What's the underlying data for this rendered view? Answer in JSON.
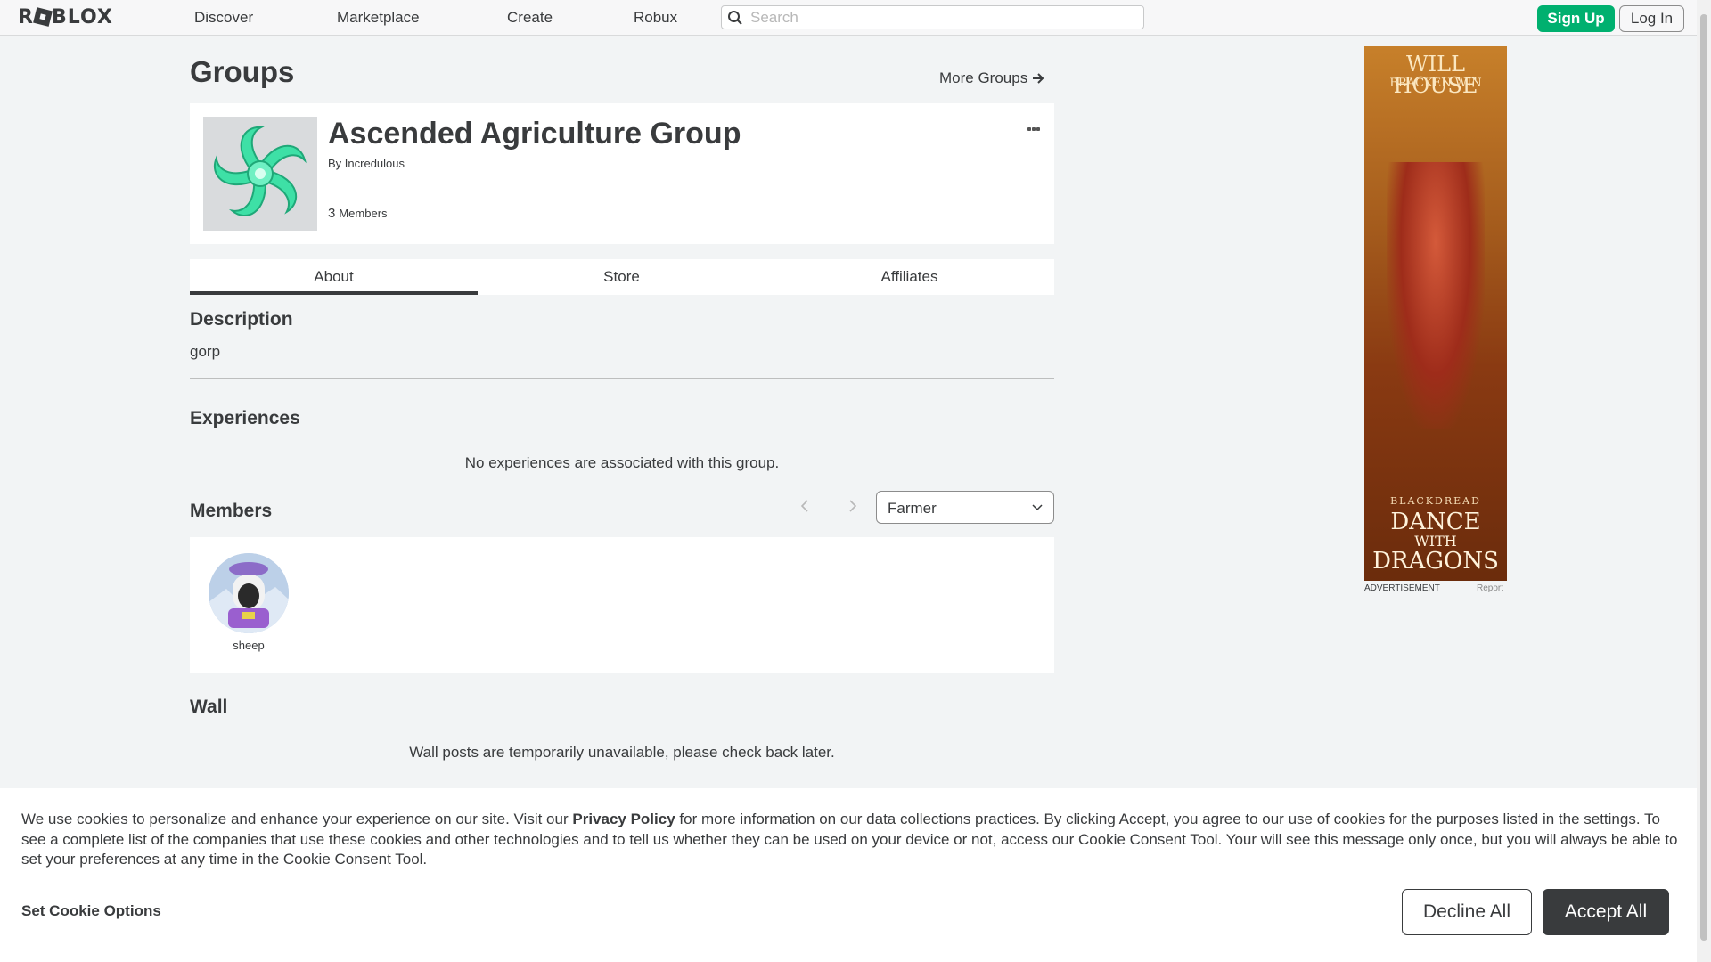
{
  "nav": {
    "logo": "ROBLOX",
    "links": [
      "Discover",
      "Marketplace",
      "Create",
      "Robux"
    ],
    "search_placeholder": "Search",
    "signup_label": "Sign Up",
    "login_label": "Log In"
  },
  "page": {
    "title": "Groups",
    "more_groups": "More Groups"
  },
  "group": {
    "name": "Ascended Agriculture Group",
    "by_prefix": "By",
    "owner": "Incredulous",
    "member_count": "3",
    "members_label": "Members",
    "emblem_icon": "group-emblem-icon"
  },
  "tabs": [
    {
      "label": "About",
      "active": true
    },
    {
      "label": "Store",
      "active": false
    },
    {
      "label": "Affiliates",
      "active": false
    }
  ],
  "about": {
    "description_heading": "Description",
    "description_text": "gorp",
    "experiences_heading": "Experiences",
    "experiences_empty": "No experiences are associated with this group.",
    "members_heading": "Members",
    "role_selected": "Farmer",
    "members": [
      {
        "name": "sheep"
      }
    ],
    "wall_heading": "Wall",
    "wall_empty": "Wall posts are temporarily unavailable, please check back later."
  },
  "ad": {
    "top_line1": "WILL HOUSE",
    "top_line2": "BRACKEN WIN",
    "small_line": "BLACKDREAD",
    "title_line1": "DANCE",
    "title_line2": "WITH",
    "title_line3": "DRAGONS",
    "label": "ADVERTISEMENT",
    "report": "Report"
  },
  "cookie": {
    "text_before": "We use cookies to personalize and enhance your experience on our site. Visit our ",
    "privacy_link": "Privacy Policy",
    "text_after": " for more information on our data collections practices. By clicking Accept, you agree to our use of cookies for the purposes listed in the settings. To see a complete list of the companies that use these cookies and other technologies and to tell us whether they can be used on your device or not, access our Cookie Consent Tool. Your will see this message only once, but you will always be able to set your preferences at any time in the Cookie Consent Tool.",
    "set_options": "Set Cookie Options",
    "decline_label": "Decline All",
    "accept_label": "Accept All"
  },
  "colors": {
    "accent_green": "#00b06f",
    "text_dark": "#393b3d",
    "background": "#f2f4f5"
  }
}
